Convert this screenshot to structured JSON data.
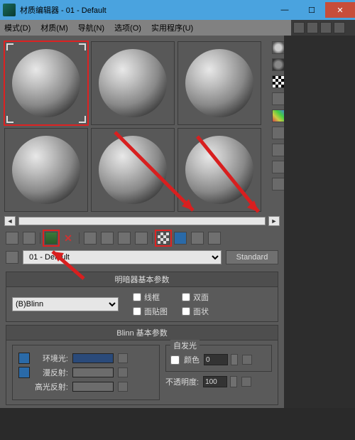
{
  "window": {
    "title": "材质编辑器 - 01 - Default"
  },
  "menu": {
    "mode": "模式(D)",
    "material": "材质(M)",
    "navigate": "导航(N)",
    "options": "选项(O)",
    "utilities": "实用程序(U)"
  },
  "material_name": "01 - Default",
  "material_type_button": "Standard",
  "rollouts": {
    "shader_basic": {
      "title": "明暗器基本参数",
      "shader": "(B)Blinn",
      "wire": "线框",
      "two_sided": "双面",
      "face_map": "面贴图",
      "faceted": "面状"
    },
    "blinn_basic": {
      "title": "Blinn 基本参数",
      "ambient": "环境光:",
      "diffuse": "漫反射:",
      "specular": "高光反射:",
      "self_illum_group": "自发光",
      "color_label": "颜色",
      "color_value": "0",
      "opacity_label": "不透明度:",
      "opacity_value": "100"
    }
  },
  "side_tool_icons": [
    "sample-type-icon",
    "backlight-icon",
    "background-icon",
    "sample-uv-icon",
    "video-check-icon",
    "make-preview-icon",
    "options-icon",
    "select-by-icon",
    "mtl-map-nav-icon"
  ],
  "toolbar_icons": [
    "get-material-icon",
    "put-to-scene-icon",
    "assign-to-selection-icon",
    "reset-icon",
    "make-copy-icon",
    "make-unique-icon",
    "put-to-lib-icon",
    "mtl-id-icon",
    "show-map-icon",
    "show-end-icon",
    "go-parent-icon",
    "go-forward-icon"
  ]
}
